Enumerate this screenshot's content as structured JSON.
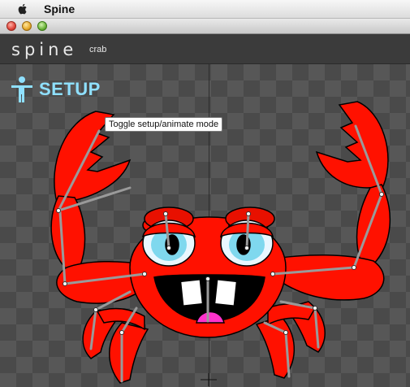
{
  "menubar": {
    "app_name": "Spine"
  },
  "toolbar": {
    "logo": "spine",
    "project_name": "crab"
  },
  "viewport": {
    "mode_label": "SETUP",
    "tooltip": "Toggle setup/animate mode"
  },
  "colors": {
    "crab_red": "#ff0000",
    "mode_accent": "#8fe0ff",
    "bone": "#9a9a9a"
  }
}
